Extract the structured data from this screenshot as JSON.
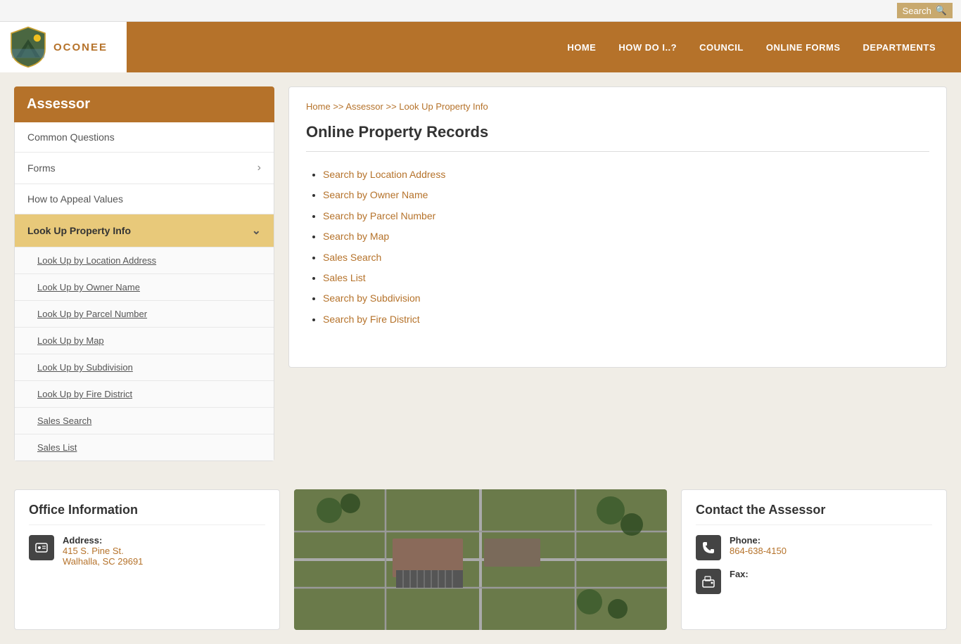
{
  "topbar": {
    "search_label": "Search"
  },
  "header": {
    "logo_text": "OCONEE",
    "nav_items": [
      {
        "label": "HOME",
        "id": "nav-home"
      },
      {
        "label": "HOW DO I..?",
        "id": "nav-how"
      },
      {
        "label": "COUNCIL",
        "id": "nav-council"
      },
      {
        "label": "ONLINE FORMS",
        "id": "nav-forms"
      },
      {
        "label": "DEPARTMENTS",
        "id": "nav-departments"
      }
    ]
  },
  "sidebar": {
    "title": "Assessor",
    "items": [
      {
        "label": "Common Questions",
        "id": "common-questions",
        "active": false,
        "sub": false
      },
      {
        "label": "Forms",
        "id": "forms",
        "active": false,
        "sub": false,
        "has_arrow": true
      },
      {
        "label": "How to Appeal Values",
        "id": "appeal-values",
        "active": false,
        "sub": false
      },
      {
        "label": "Look Up Property Info",
        "id": "lookup-property",
        "active": true,
        "sub": false,
        "has_arrow": true
      },
      {
        "label": "Look Up by Location Address",
        "id": "lookup-location",
        "active": false,
        "sub": true
      },
      {
        "label": "Look Up by Owner Name",
        "id": "lookup-owner",
        "active": false,
        "sub": true
      },
      {
        "label": "Look Up by Parcel Number",
        "id": "lookup-parcel",
        "active": false,
        "sub": true
      },
      {
        "label": "Look Up by Map",
        "id": "lookup-map",
        "active": false,
        "sub": true
      },
      {
        "label": "Look Up by Subdivision",
        "id": "lookup-subdivision",
        "active": false,
        "sub": true
      },
      {
        "label": "Look Up by Fire District",
        "id": "lookup-fire",
        "active": false,
        "sub": true
      },
      {
        "label": "Sales Search",
        "id": "sales-search",
        "active": false,
        "sub": true
      },
      {
        "label": "Sales List",
        "id": "sales-list",
        "active": false,
        "sub": true
      }
    ]
  },
  "breadcrumb": {
    "home": "Home",
    "separator": ">>",
    "assessor": "Assessor",
    "current": "Look Up Property Info"
  },
  "content": {
    "title": "Online Property Records",
    "links": [
      {
        "label": "Search by Location Address",
        "id": "link-location"
      },
      {
        "label": "Search by Owner Name",
        "id": "link-owner"
      },
      {
        "label": "Search by Parcel Number",
        "id": "link-parcel"
      },
      {
        "label": "Search by Map",
        "id": "link-map"
      },
      {
        "label": "Sales Search",
        "id": "link-sales-search"
      },
      {
        "label": "Sales List",
        "id": "link-sales-list"
      },
      {
        "label": "Search by Subdivision",
        "id": "link-subdivision"
      },
      {
        "label": "Search by Fire District",
        "id": "link-fire-district"
      }
    ]
  },
  "footer": {
    "office_info": {
      "title": "Office Information",
      "address_label": "Address:",
      "address_line1": "415 S. Pine St.",
      "address_line2": "Walhalla, SC 29691"
    },
    "contact": {
      "title": "Contact the Assessor",
      "phone_label": "Phone:",
      "phone_value": "864-638-4150",
      "fax_label": "Fax:"
    }
  }
}
